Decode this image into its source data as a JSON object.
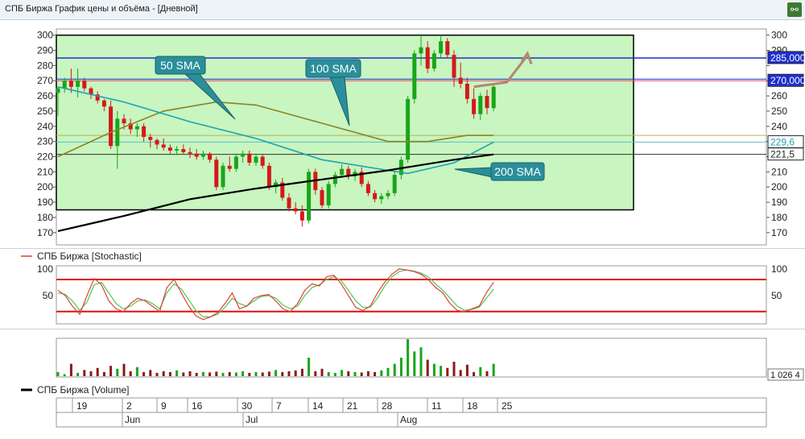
{
  "window": {
    "title": "СПБ Биржа График цены и объёма - [Дневной]",
    "icon": "chart-link-icon"
  },
  "colors": {
    "up": "#1aa51a",
    "down": "#d41919",
    "zone": "#c8f5c0",
    "sma50": "#1aa3b3",
    "sma100": "#8a8420",
    "sma200": "#000000",
    "blue_level": "#1f2fd0",
    "pink_level": "#e0407a",
    "stoch_k": "#e04040",
    "stoch_d": "#4fc94f"
  },
  "price_panel": {
    "yticks": [
      "170",
      "180",
      "190",
      "200",
      "210",
      "220",
      "230",
      "240",
      "250",
      "260",
      "270",
      "280",
      "290",
      "300"
    ],
    "ymin": 163,
    "ymax": 303,
    "badges": {
      "level_285": "285,000",
      "level_270": "270,000",
      "sma50_last": "229,6",
      "sma200_last": "221,5"
    },
    "callouts": {
      "sma50": "50 SMA",
      "sma100": "100 SMA",
      "sma200": "200 SMA"
    }
  },
  "stoch_panel": {
    "legend": "СПБ Биржа [Stochastic]",
    "yticks": [
      "100",
      "50"
    ],
    "upper": 80,
    "lower": 20
  },
  "volume_panel": {
    "legend": "СПБ Биржа [Volume]",
    "last_value": "1 026 4"
  },
  "x_axis": {
    "days": [
      "19",
      "2",
      "9",
      "16",
      "30",
      "7",
      "14",
      "21",
      "28",
      "11",
      "18",
      "25"
    ],
    "months": [
      "Jun",
      "Jul",
      "Aug"
    ]
  },
  "chart_data": {
    "type": "candlestick",
    "candles": [
      [
        262,
        266,
        247,
        265
      ],
      [
        265,
        272,
        262,
        270
      ],
      [
        270,
        278,
        262,
        266
      ],
      [
        266,
        278,
        259,
        270
      ],
      [
        270,
        272,
        263,
        265
      ],
      [
        265,
        266,
        258,
        261
      ],
      [
        261,
        263,
        255,
        257
      ],
      [
        257,
        258,
        250,
        253
      ],
      [
        253,
        257,
        225,
        227
      ],
      [
        227,
        250,
        212,
        245
      ],
      [
        245,
        248,
        238,
        242
      ],
      [
        242,
        245,
        235,
        238
      ],
      [
        238,
        242,
        233,
        240
      ],
      [
        240,
        242,
        230,
        233
      ],
      [
        233,
        235,
        226,
        231
      ],
      [
        231,
        232,
        225,
        228
      ],
      [
        228,
        232,
        224,
        226
      ],
      [
        226,
        228,
        222,
        224
      ],
      [
        224,
        227,
        221,
        225
      ],
      [
        225,
        228,
        222,
        223
      ],
      [
        223,
        226,
        219,
        222
      ],
      [
        222,
        225,
        218,
        220
      ],
      [
        220,
        224,
        218,
        222
      ],
      [
        222,
        223,
        216,
        218
      ],
      [
        218,
        220,
        198,
        200
      ],
      [
        200,
        216,
        198,
        214
      ],
      [
        214,
        220,
        210,
        212
      ],
      [
        212,
        222,
        210,
        220
      ],
      [
        220,
        224,
        216,
        222
      ],
      [
        222,
        224,
        214,
        216
      ],
      [
        216,
        222,
        214,
        220
      ],
      [
        220,
        222,
        212,
        214
      ],
      [
        214,
        216,
        198,
        200
      ],
      [
        200,
        205,
        196,
        203
      ],
      [
        203,
        206,
        191,
        193
      ],
      [
        193,
        196,
        184,
        186
      ],
      [
        186,
        190,
        182,
        184
      ],
      [
        184,
        188,
        174,
        178
      ],
      [
        178,
        212,
        176,
        210
      ],
      [
        210,
        212,
        195,
        198
      ],
      [
        198,
        200,
        186,
        188
      ],
      [
        188,
        204,
        186,
        202
      ],
      [
        202,
        210,
        200,
        208
      ],
      [
        208,
        215,
        206,
        212
      ],
      [
        212,
        214,
        205,
        207
      ],
      [
        207,
        212,
        204,
        210
      ],
      [
        210,
        213,
        200,
        202
      ],
      [
        202,
        204,
        194,
        196
      ],
      [
        196,
        198,
        190,
        192
      ],
      [
        192,
        196,
        189,
        194
      ],
      [
        194,
        198,
        192,
        196
      ],
      [
        196,
        210,
        194,
        208
      ],
      [
        208,
        220,
        205,
        218
      ],
      [
        218,
        260,
        216,
        258
      ],
      [
        258,
        290,
        255,
        288
      ],
      [
        288,
        301,
        280,
        292
      ],
      [
        292,
        296,
        275,
        278
      ],
      [
        278,
        290,
        276,
        288
      ],
      [
        288,
        300,
        285,
        296
      ],
      [
        296,
        298,
        285,
        287
      ],
      [
        287,
        290,
        266,
        272
      ],
      [
        272,
        282,
        265,
        268
      ],
      [
        268,
        272,
        255,
        258
      ],
      [
        258,
        265,
        245,
        248
      ],
      [
        248,
        262,
        244,
        260
      ],
      [
        260,
        264,
        248,
        252
      ],
      [
        252,
        268,
        250,
        266
      ]
    ],
    "sma50": [
      [
        0,
        266
      ],
      [
        10,
        256
      ],
      [
        20,
        243
      ],
      [
        30,
        232
      ],
      [
        40,
        218
      ],
      [
        50,
        211
      ],
      [
        53,
        209
      ],
      [
        60,
        216
      ],
      [
        66,
        229.6
      ]
    ],
    "sma100": [
      [
        0,
        220
      ],
      [
        8,
        236
      ],
      [
        16,
        250
      ],
      [
        24,
        256
      ],
      [
        30,
        254
      ],
      [
        40,
        242
      ],
      [
        50,
        230
      ],
      [
        56,
        230
      ],
      [
        62,
        234
      ],
      [
        66,
        234
      ]
    ],
    "sma200": [
      [
        0,
        171
      ],
      [
        10,
        181
      ],
      [
        20,
        192
      ],
      [
        30,
        199
      ],
      [
        40,
        205
      ],
      [
        50,
        211
      ],
      [
        60,
        218
      ],
      [
        66,
        221.5
      ]
    ],
    "levels": {
      "blue": 285,
      "pink": 270
    },
    "stochastic": {
      "k": [
        60,
        50,
        30,
        15,
        50,
        82,
        70,
        40,
        25,
        20,
        35,
        45,
        40,
        30,
        20,
        65,
        80,
        55,
        30,
        12,
        5,
        10,
        18,
        35,
        55,
        25,
        30,
        45,
        50,
        52,
        40,
        25,
        20,
        35,
        60,
        72,
        68,
        85,
        88,
        72,
        50,
        28,
        22,
        30,
        55,
        75,
        90,
        100,
        98,
        95,
        90,
        80,
        65,
        55,
        35,
        22,
        20,
        25,
        30,
        55,
        75
      ],
      "d": [
        55,
        52,
        40,
        22,
        38,
        70,
        75,
        55,
        35,
        25,
        30,
        40,
        42,
        35,
        25,
        55,
        72,
        62,
        42,
        22,
        10,
        10,
        15,
        28,
        45,
        35,
        30,
        40,
        48,
        50,
        45,
        32,
        25,
        30,
        50,
        65,
        70,
        80,
        85,
        78,
        60,
        40,
        28,
        28,
        45,
        68,
        85,
        95,
        98,
        96,
        92,
        85,
        72,
        60,
        45,
        30,
        22,
        24,
        28,
        45,
        62
      ]
    },
    "volume": [
      10,
      5,
      30,
      8,
      15,
      12,
      20,
      10,
      25,
      18,
      30,
      12,
      22,
      10,
      15,
      8,
      12,
      10,
      14,
      9,
      12,
      8,
      10,
      9,
      11,
      8,
      10,
      9,
      12,
      8,
      10,
      9,
      11,
      15,
      10,
      12,
      14,
      18,
      45,
      12,
      18,
      10,
      8,
      15,
      12,
      10,
      9,
      12,
      10,
      14,
      20,
      30,
      45,
      90,
      60,
      70,
      40,
      30,
      25,
      20,
      35,
      15,
      28,
      10,
      22,
      12,
      30
    ]
  }
}
